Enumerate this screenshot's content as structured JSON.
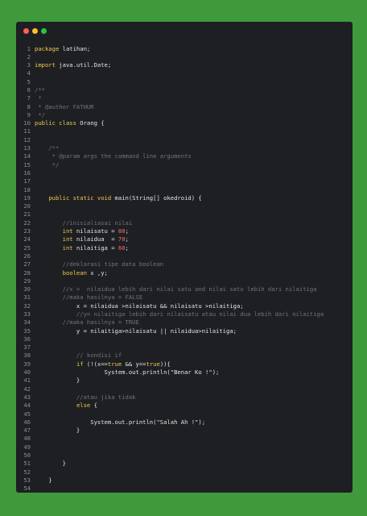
{
  "window": {
    "controls": [
      "close",
      "minimize",
      "maximize"
    ]
  },
  "colors": {
    "background": "#3f9a3c",
    "editor": "#1d1f23",
    "keyword": "#f2c94c",
    "comment": "#6f747b",
    "number": "#ff6b6b"
  },
  "code_lines": [
    [
      {
        "t": "package",
        "c": "kw"
      },
      {
        "t": " latihan;"
      }
    ],
    [],
    [
      {
        "t": "import",
        "c": "kw"
      },
      {
        "t": " java.util.Date;"
      }
    ],
    [],
    [],
    [
      {
        "t": "/**",
        "c": "cm"
      }
    ],
    [
      {
        "t": " *",
        "c": "cm"
      }
    ],
    [
      {
        "t": " * @author FATHUR",
        "c": "cm"
      }
    ],
    [
      {
        "t": " */",
        "c": "cm"
      }
    ],
    [
      {
        "t": "public class",
        "c": "kw"
      },
      {
        "t": " Orang {"
      }
    ],
    [],
    [],
    [
      {
        "t": "    /**",
        "c": "cm"
      }
    ],
    [
      {
        "t": "     * @param args the command line arguments",
        "c": "cm"
      }
    ],
    [
      {
        "t": "     */",
        "c": "cm"
      }
    ],
    [],
    [],
    [],
    [
      {
        "t": "    "
      },
      {
        "t": "public static void",
        "c": "kw"
      },
      {
        "t": " main(String[] okedroid) {"
      }
    ],
    [],
    [],
    [
      {
        "t": "        //inisialiasai nilai",
        "c": "cm"
      }
    ],
    [
      {
        "t": "        "
      },
      {
        "t": "int",
        "c": "kw"
      },
      {
        "t": " nilaisatu = "
      },
      {
        "t": "80",
        "c": "num"
      },
      {
        "t": ";"
      }
    ],
    [
      {
        "t": "        "
      },
      {
        "t": "int",
        "c": "kw"
      },
      {
        "t": " nilaidua  = "
      },
      {
        "t": "70",
        "c": "num"
      },
      {
        "t": ";"
      }
    ],
    [
      {
        "t": "        "
      },
      {
        "t": "int",
        "c": "kw"
      },
      {
        "t": " nilaitiga = "
      },
      {
        "t": "60",
        "c": "num"
      },
      {
        "t": ";"
      }
    ],
    [],
    [
      {
        "t": "        //deklarasi tipe data boolean",
        "c": "cm"
      }
    ],
    [
      {
        "t": "        "
      },
      {
        "t": "boolean",
        "c": "kw"
      },
      {
        "t": " x ,y;"
      }
    ],
    [],
    [
      {
        "t": "        //x =  nilaidua lebih dari nilai satu and nilai satu lebih dari nilaitiga",
        "c": "cm"
      }
    ],
    [
      {
        "t": "        //maka hasilnya = FALSE",
        "c": "cm"
      }
    ],
    [
      {
        "t": "            x = nilaidua >nilaisatu && nilaisatu >nilaitiga;"
      }
    ],
    [
      {
        "t": "            //y= nilaitiga lebih dari nilaisatu atau nilai dua lebih dari nilaitiga",
        "c": "cm"
      }
    ],
    [
      {
        "t": "        //maka hasilnya = TRUE",
        "c": "cm"
      }
    ],
    [
      {
        "t": "            y = nilaitiga>nilaisatu || nilaidua>nilaitiga;"
      }
    ],
    [],
    [],
    [
      {
        "t": "            // kondisi if",
        "c": "cm"
      }
    ],
    [
      {
        "t": "            "
      },
      {
        "t": "if",
        "c": "kw"
      },
      {
        "t": " (!(x=="
      },
      {
        "t": "true",
        "c": "kw"
      },
      {
        "t": " && y=="
      },
      {
        "t": "true",
        "c": "kw"
      },
      {
        "t": ")){"
      }
    ],
    [
      {
        "t": "                    System.out.println(\"Benar Ko !\");"
      }
    ],
    [
      {
        "t": "            }"
      }
    ],
    [],
    [
      {
        "t": "            //atau jika tidak",
        "c": "cm"
      }
    ],
    [
      {
        "t": "            "
      },
      {
        "t": "else",
        "c": "kw"
      },
      {
        "t": " {"
      }
    ],
    [],
    [
      {
        "t": "                System.out.println(\"Salah Ah !\");"
      }
    ],
    [
      {
        "t": "            }"
      }
    ],
    [],
    [],
    [],
    [
      {
        "t": "        }"
      }
    ],
    [],
    [
      {
        "t": "    }"
      }
    ],
    []
  ]
}
